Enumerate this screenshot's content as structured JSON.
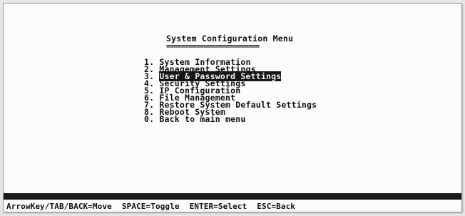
{
  "screen": {
    "title": "System Configuration Menu",
    "title_underline": "========================="
  },
  "menu": {
    "selected_index": 2,
    "items": [
      {
        "number": "1.",
        "label": "System Information"
      },
      {
        "number": "2.",
        "label": "Management Settings"
      },
      {
        "number": "3.",
        "label": "User & Password Settings"
      },
      {
        "number": "4.",
        "label": "Security Settings"
      },
      {
        "number": "5.",
        "label": "IP Configuration"
      },
      {
        "number": "6.",
        "label": "File Management"
      },
      {
        "number": "7.",
        "label": "Restore System Default Settings"
      },
      {
        "number": "8.",
        "label": "Reboot System"
      },
      {
        "number": "0.",
        "label": "Back to main menu"
      }
    ]
  },
  "statusbar": {
    "move": "ArrowKey/TAB/BACK=Move",
    "toggle": "SPACE=Toggle",
    "select": "ENTER=Select",
    "back": "ESC=Back"
  }
}
